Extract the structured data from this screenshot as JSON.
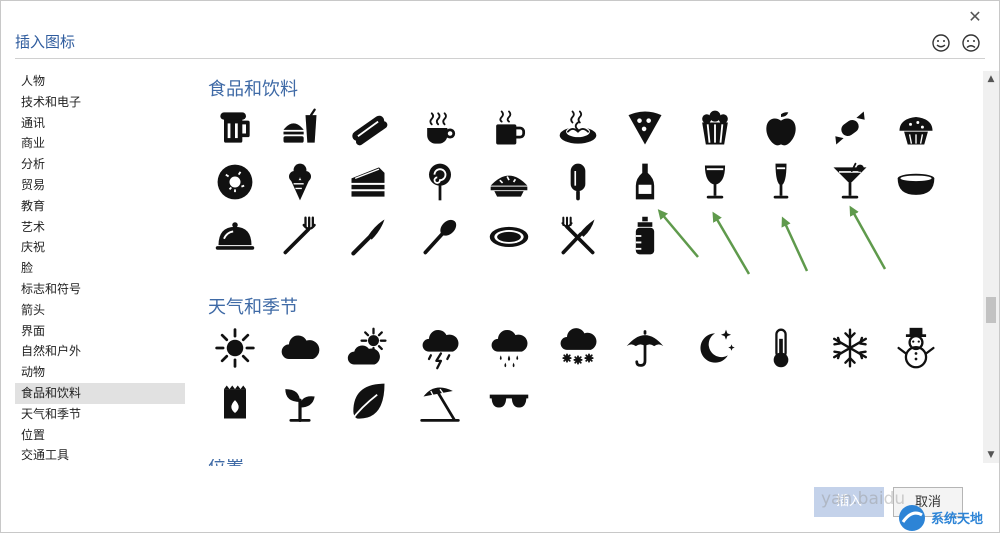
{
  "dialog": {
    "title": "插入图标",
    "insert_label": "插入",
    "cancel_label": "取消",
    "watermark_text": "yan.baidu",
    "site_logo_text": "系统天地"
  },
  "sidebar": {
    "selected_index": 15,
    "items": [
      {
        "label": "人物"
      },
      {
        "label": "技术和电子"
      },
      {
        "label": "通讯"
      },
      {
        "label": "商业"
      },
      {
        "label": "分析"
      },
      {
        "label": "贸易"
      },
      {
        "label": "教育"
      },
      {
        "label": "艺术"
      },
      {
        "label": "庆祝"
      },
      {
        "label": "脸"
      },
      {
        "label": "标志和符号"
      },
      {
        "label": "箭头"
      },
      {
        "label": "界面"
      },
      {
        "label": "自然和户外"
      },
      {
        "label": "动物"
      },
      {
        "label": "食品和饮料"
      },
      {
        "label": "天气和季节"
      },
      {
        "label": "位置"
      },
      {
        "label": "交通工具"
      }
    ]
  },
  "sections": [
    {
      "title": "食品和饮料",
      "icons": [
        "beer-mug-icon",
        "burger-drink-icon",
        "hot-dog-icon",
        "hot-coffee-cup-icon",
        "coffee-mug-icon",
        "spaghetti-plate-icon",
        "pizza-slice-icon",
        "popcorn-icon",
        "apple-icon",
        "candy-icon",
        "muffin-icon",
        "donut-icon",
        "ice-cream-cone-icon",
        "cake-slice-icon",
        "lollipop-icon",
        "pie-icon",
        "popsicle-icon",
        "wine-bottle-icon",
        "wine-glass-icon",
        "champagne-flute-icon",
        "cocktail-glass-icon",
        "bowl-icon",
        "cloche-icon",
        "fork-icon",
        "knife-icon",
        "spoon-icon",
        "plate-icon",
        "fork-knife-icon",
        "baby-bottle-icon"
      ]
    },
    {
      "title": "天气和季节",
      "icons": [
        "sun-icon",
        "cloud-icon",
        "sun-cloud-icon",
        "thunderstorm-icon",
        "rain-cloud-icon",
        "snow-cloud-icon",
        "umbrella-icon",
        "moon-stars-icon",
        "thermometer-icon",
        "snowflake-icon",
        "snowman-icon",
        "seed-bag-icon",
        "sprout-icon",
        "leaf-icon",
        "beach-umbrella-icon",
        "sunglasses-icon"
      ]
    },
    {
      "title": "位置"
    }
  ],
  "colors": {
    "accent": "#3f6aa6",
    "title": "#2f5c9e",
    "arrow": "#5f9a4c",
    "selected_bg": "#e1e1e1"
  }
}
